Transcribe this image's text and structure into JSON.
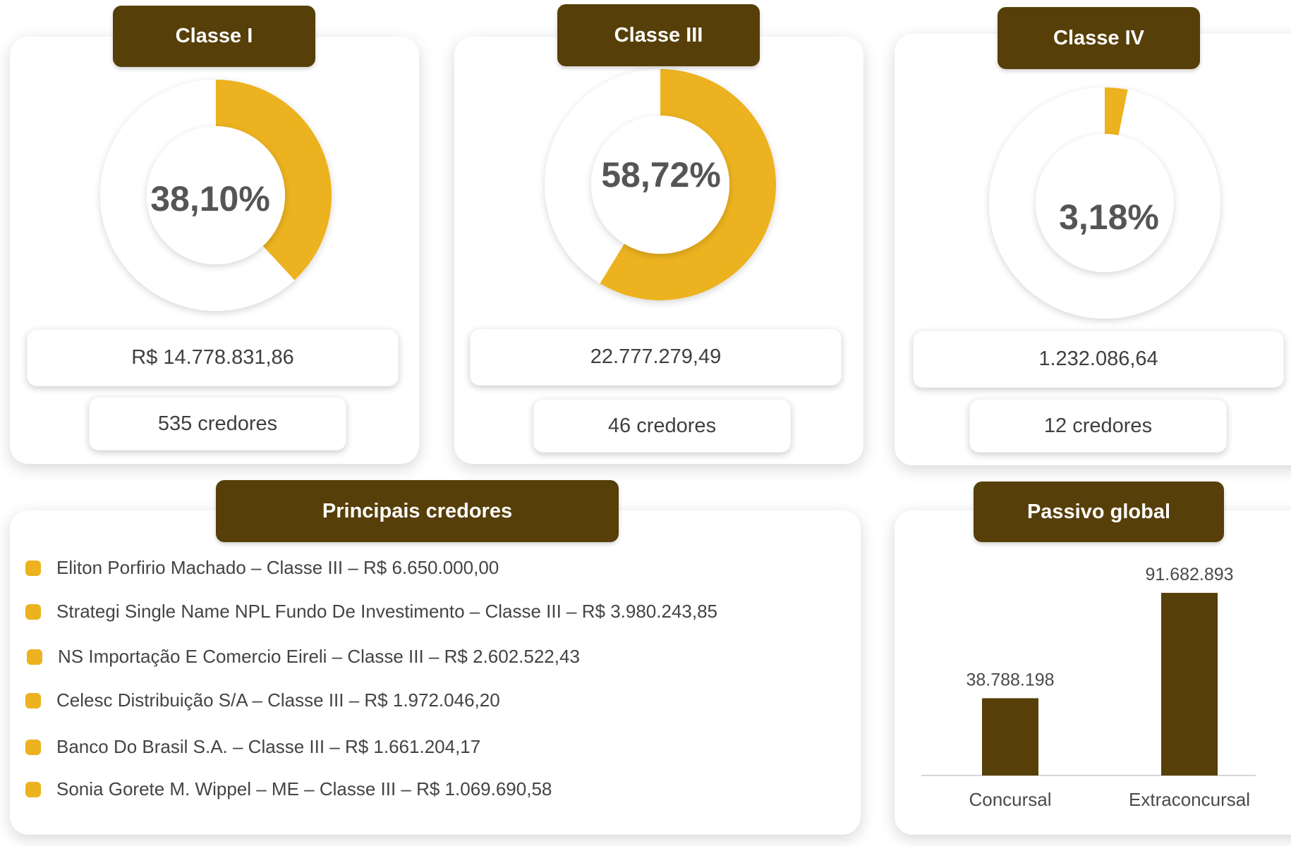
{
  "colors": {
    "brown": "#573f09",
    "gold": "#ecb21f",
    "track": "#ffffff"
  },
  "classes": [
    {
      "badge": "Classe I",
      "percent_label": "38,10%",
      "percent": 38.1,
      "amount": "R$ 14.778.831,86",
      "creditors": "535 credores"
    },
    {
      "badge": "Classe III",
      "percent_label": "58,72%",
      "percent": 58.72,
      "amount": "22.777.279,49",
      "creditors": "46 credores"
    },
    {
      "badge": "Classe IV",
      "percent_label": "3,18%",
      "percent": 3.18,
      "amount": "1.232.086,64",
      "creditors": "12 credores"
    }
  ],
  "creditors_panel": {
    "title": "Principais credores",
    "items": [
      "Eliton Porfirio Machado – Classe III – R$ 6.650.000,00",
      "Strategi Single Name NPL Fundo De Investimento – Classe III – R$ 3.980.243,85",
      "NS Importação E Comercio Eireli – Classe III – R$ 2.602.522,43",
      "Celesc Distribuição S/A – Classe III – R$ 1.972.046,20",
      "Banco Do Brasil S.A. – Classe III – R$ 1.661.204,17",
      "Sonia Gorete M. Wippel – ME – Classe III – R$ 1.069.690,58"
    ]
  },
  "chart_data": [
    {
      "type": "pie",
      "title": "Classe I",
      "labels": [
        "Classe I"
      ],
      "values": [
        38.1
      ],
      "display": "38,10%"
    },
    {
      "type": "pie",
      "title": "Classe III",
      "labels": [
        "Classe III"
      ],
      "values": [
        58.72
      ],
      "display": "58,72%"
    },
    {
      "type": "pie",
      "title": "Classe IV",
      "labels": [
        "Classe IV"
      ],
      "values": [
        3.18
      ],
      "display": "3,18%"
    },
    {
      "type": "bar",
      "title": "Passivo global",
      "categories": [
        "Concursal",
        "Extraconcursal"
      ],
      "values": [
        38788198,
        91682893
      ],
      "value_labels": [
        "38.788.198",
        "91.682.893"
      ],
      "ylim": [
        0,
        100000000
      ],
      "grid": false
    }
  ]
}
